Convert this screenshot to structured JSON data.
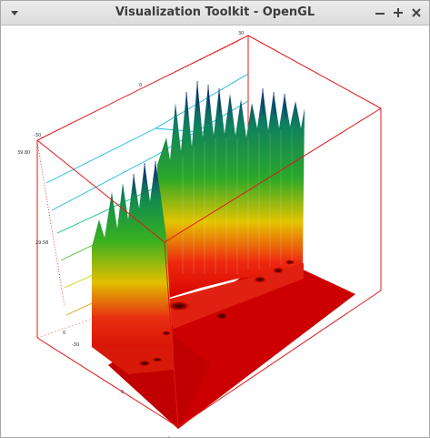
{
  "window": {
    "title": "Visualization Toolkit - OpenGL",
    "controls": {
      "menu_icon": "chevron-down-icon",
      "minimize_icon": "minimize-icon",
      "maximize_icon": "plus-icon",
      "close_icon": "close-icon"
    }
  },
  "axes": {
    "top_corner_label": "30",
    "top_axis_label": "0",
    "z_upper_tick": "39.80",
    "z_mid_tick": "29.58",
    "left_corner_label": "-30",
    "z_zero_tick": "0",
    "y_left_tick": "-30",
    "bottom_axis_label": "0",
    "bottom_corner_label": "-"
  },
  "colors": {
    "axis_box": "#e01818",
    "surface_base": "#cc0000",
    "surface_mid": "#e0c000",
    "surface_high": "#10a010",
    "spike_top": "#102a7a",
    "contour_cyan": "#18b8d8"
  }
}
